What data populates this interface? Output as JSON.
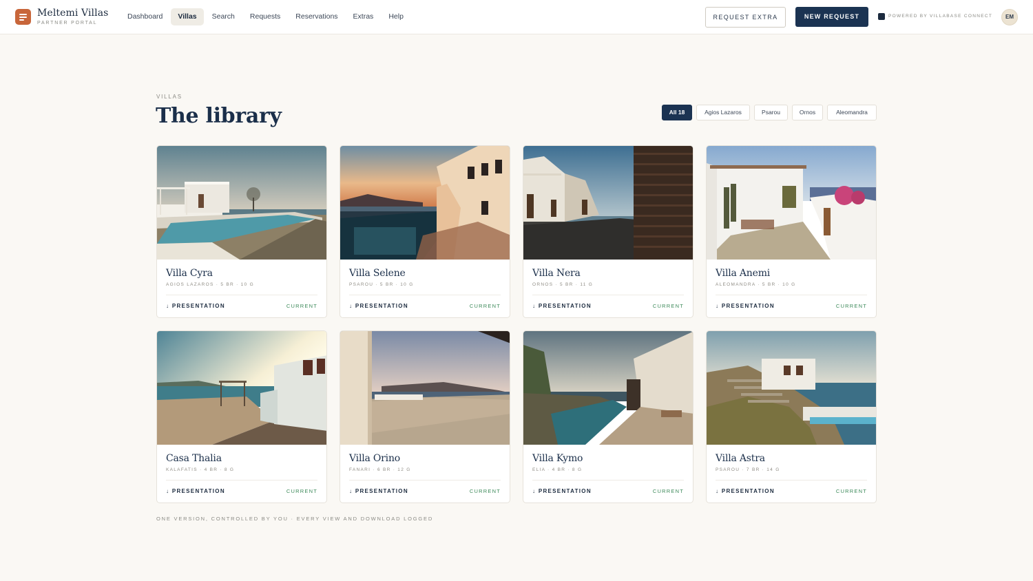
{
  "app": {
    "brand_name": "Meltemi Villas",
    "brand_sub": "PARTNER PORTAL"
  },
  "nav": {
    "items": [
      {
        "label": "Dashboard",
        "active": false
      },
      {
        "label": "Villas",
        "active": true
      },
      {
        "label": "Search",
        "active": false
      },
      {
        "label": "Requests",
        "active": false
      },
      {
        "label": "Reservations",
        "active": false
      },
      {
        "label": "Extras",
        "active": false
      },
      {
        "label": "Help",
        "active": false
      }
    ]
  },
  "header": {
    "request_extra_label": "REQUEST EXTRA",
    "new_request_label": "NEW REQUEST",
    "powered_by": "POWERED BY VILLABASE CONNECT",
    "avatar_initials": "EM"
  },
  "page": {
    "eyebrow": "VILLAS",
    "title": "The library",
    "footnote": "ONE VERSION, CONTROLLED BY YOU · EVERY VIEW AND DOWNLOAD LOGGED"
  },
  "filters": [
    {
      "label": "All 18",
      "active": true
    },
    {
      "label": "Agios Lazaros",
      "active": false
    },
    {
      "label": "Psarou",
      "active": false
    },
    {
      "label": "Ornos",
      "active": false
    },
    {
      "label": "Aleomandra",
      "active": false
    }
  ],
  "villas": [
    {
      "name": "Villa Cyra",
      "meta": "AGIOS LAZAROS · 5 BR · 10 G",
      "action": "↓ PRESENTATION",
      "status": "CURRENT"
    },
    {
      "name": "Villa Selene",
      "meta": "PSAROU · 5 BR · 10 G",
      "action": "↓ PRESENTATION",
      "status": "CURRENT"
    },
    {
      "name": "Villa Nera",
      "meta": "ORNOS · 5 BR · 11 G",
      "action": "↓ PRESENTATION",
      "status": "CURRENT"
    },
    {
      "name": "Villa Anemi",
      "meta": "ALEOMANDRA · 5 BR · 10 G",
      "action": "↓ PRESENTATION",
      "status": "CURRENT"
    },
    {
      "name": "Casa Thalia",
      "meta": "KALAFATIS · 4 BR · 8 G",
      "action": "↓ PRESENTATION",
      "status": "CURRENT"
    },
    {
      "name": "Villa Orino",
      "meta": "FANARI · 6 BR · 12 G",
      "action": "↓ PRESENTATION",
      "status": "CURRENT"
    },
    {
      "name": "Villa Kymo",
      "meta": "ELIA · 4 BR · 8 G",
      "action": "↓ PRESENTATION",
      "status": "CURRENT"
    },
    {
      "name": "Villa Astra",
      "meta": "PSAROU · 7 BR · 14 G",
      "action": "↓ PRESENTATION",
      "status": "CURRENT"
    }
  ],
  "colors": {
    "accent": "#1b3352",
    "brand": "#c8663a",
    "status_current": "#3d8a5a",
    "background": "#faf8f4"
  }
}
